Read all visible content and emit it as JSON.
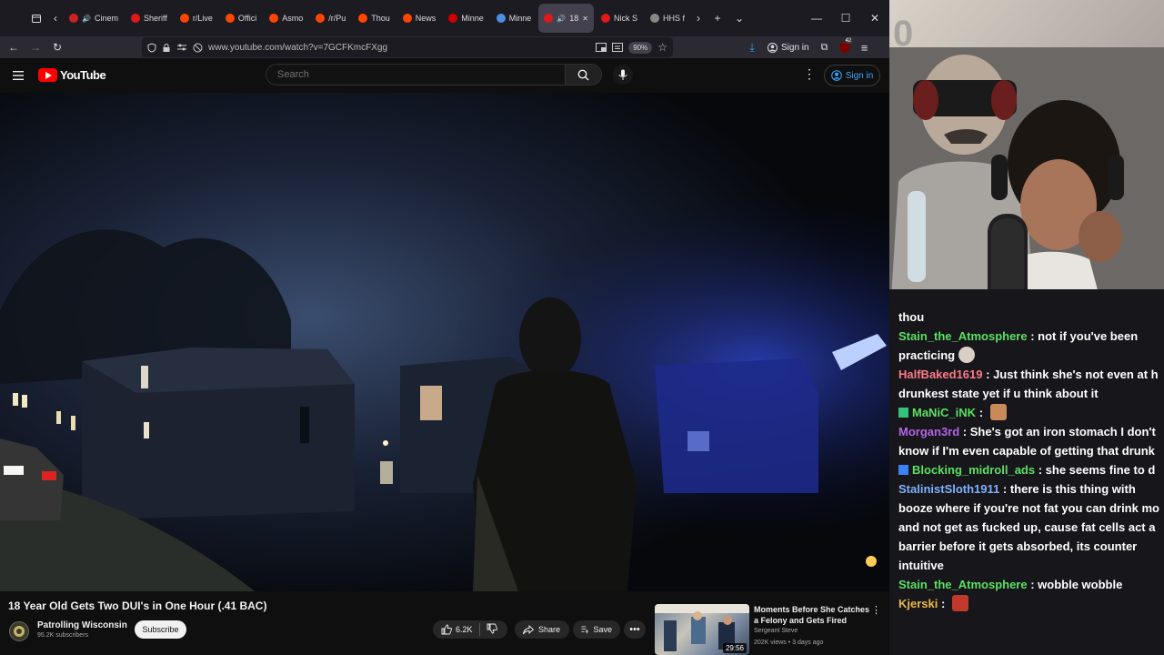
{
  "browser": {
    "tabs": [
      {
        "label": "Cinem",
        "favicon_color": "#cc2222",
        "audio": true
      },
      {
        "label": "Sheriff",
        "favicon_color": "#e01818"
      },
      {
        "label": "r/Live",
        "favicon_color": "#ff4500"
      },
      {
        "label": "Offici",
        "favicon_color": "#ff4500"
      },
      {
        "label": "Asmo",
        "favicon_color": "#ff4500"
      },
      {
        "label": "/r/Pu",
        "favicon_color": "#ff4500"
      },
      {
        "label": "Thou",
        "favicon_color": "#ff4500"
      },
      {
        "label": "News",
        "favicon_color": "#ff4500"
      },
      {
        "label": "Minne",
        "favicon_color": "#d00000"
      },
      {
        "label": "Minne",
        "favicon_color": "#4a90e2"
      },
      {
        "label": "18",
        "favicon_color": "#e01818",
        "active": true,
        "audio": true
      },
      {
        "label": "Nick S",
        "favicon_color": "#e01818"
      },
      {
        "label": "HHS f",
        "favicon_color": "#888888"
      }
    ],
    "url": "www.youtube.com/watch?v=7GCFKmcFXgg",
    "zoom": "90%",
    "signin_label": "Sign in",
    "notification_count": "42"
  },
  "youtube": {
    "logo_text": "YouTube",
    "search_placeholder": "Search",
    "signin_label": "Sign in",
    "video": {
      "title": "18 Year Old Gets Two DUI's in One Hour (.41 BAC)",
      "channel": "Patrolling Wisconsin",
      "subscribers": "95.2K subscribers",
      "subscribe_label": "Subscribe",
      "likes": "6.2K",
      "share_label": "Share",
      "save_label": "Save"
    },
    "recommended": {
      "title": "Moments Before She Catches a Felony and Gets Fired",
      "channel": "Sergeant Steve",
      "meta": "202K views • 3 days ago",
      "duration": "29:56"
    }
  },
  "stream": {
    "chat": [
      {
        "user": "",
        "color": "#ffffff",
        "text": "thou"
      },
      {
        "user": "Stain_the_Atmosphere",
        "color": "#5ce065",
        "text": "not if you've been",
        "cont": "practicing",
        "emote": "#d9d0c5"
      },
      {
        "user": "HalfBaked1619",
        "color": "#ff7a8a",
        "text": "Just think she's not even at h",
        "cont": "drunkest state yet if u think about it"
      },
      {
        "user": "MaNiC_iNK",
        "color": "#5ce065",
        "text": "",
        "badge": "#31c27c",
        "emote": "#c98a5a"
      },
      {
        "user": "Morgan3rd",
        "color": "#b266e8",
        "text": "She's got an iron stomach I don't",
        "cont": "know if I'm even capable of getting that drunk"
      },
      {
        "user": "Blocking_midroll_ads",
        "color": "#5ce065",
        "text": "she seems fine to d",
        "badge": "#3b82f6"
      },
      {
        "user": "StalinistSloth1911",
        "color": "#7fb2ff",
        "text": "there is this thing with",
        "cont": "booze where if you're not fat you can drink mo",
        "cont2": "and not get as fucked up, cause fat cells act a",
        "cont3": "barrier before it gets absorbed, its counter",
        "cont4": "intuitive"
      },
      {
        "user": "Stain_the_Atmosphere",
        "color": "#5ce065",
        "text": "wobble wobble"
      },
      {
        "user": "Kjerski",
        "color": "#e8b84a",
        "text": "",
        "emote": "#c0392b"
      }
    ]
  }
}
